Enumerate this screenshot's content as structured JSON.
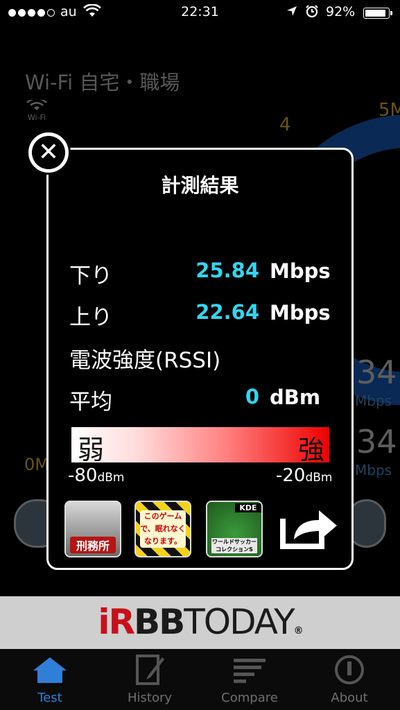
{
  "status_bar": {
    "carrier": "au",
    "time": "22:31",
    "battery_percent": "92%",
    "battery_level": 0.92,
    "location_icon": "location-arrow-icon",
    "alarm_icon": "alarm-clock-icon"
  },
  "background": {
    "title": "Wi-Fi 自宅・職場",
    "wifi_icon_label": "Wi-Fi",
    "gauge_tick_4": "4",
    "gauge_tick_5": "5M",
    "gauge_min": "0M",
    "download_value_partial": "34",
    "download_unit": "Mbps",
    "upload_value_partial": "34",
    "upload_unit": "Mbps"
  },
  "modal": {
    "title": "計測結果",
    "download_label": "下り",
    "download_value": "25.84",
    "download_unit": "Mbps",
    "upload_label": "上り",
    "upload_value": "22.64",
    "upload_unit": "Mbps",
    "rssi_label": "電波強度(RSSI)",
    "avg_label": "平均",
    "avg_value": "0",
    "avg_unit": "dBm",
    "meter_weak": "弱",
    "meter_strong": "強",
    "meter_min": "-80",
    "meter_max": "-20",
    "meter_unit": "dBm",
    "ads": [
      {
        "text": "刑務所"
      },
      {
        "text": "このゲームで、眠れなく なります。"
      },
      {
        "text_top": "KDE",
        "text_bottom": "ワールドサッカーコレクションS"
      }
    ]
  },
  "banner": {
    "logo_prefix": "iR",
    "logo_bb": "BB",
    "logo_suffix": "TODAY",
    "logo_mark": "®"
  },
  "tabs": [
    {
      "label": "Test",
      "icon": "house-icon",
      "active": true
    },
    {
      "label": "History",
      "icon": "notepad-icon",
      "active": false
    },
    {
      "label": "Compare",
      "icon": "bars-icon",
      "active": false
    },
    {
      "label": "About",
      "icon": "info-circle-icon",
      "active": false
    }
  ],
  "colors": {
    "accent_value": "#33d6ef",
    "tab_active": "#2f7fd8",
    "gauge_blue": "#1a63c9",
    "gauge_label": "#f4c838"
  }
}
